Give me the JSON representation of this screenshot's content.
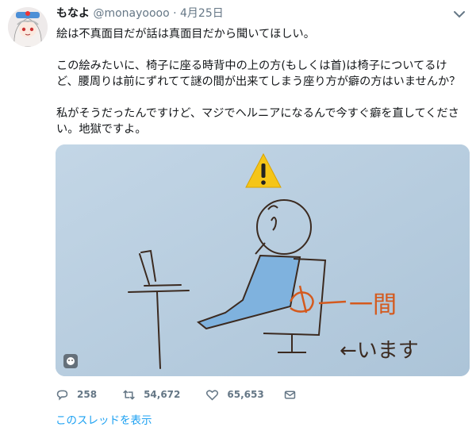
{
  "tweet": {
    "name": "もなよ",
    "handle": "@monayoooo",
    "separator": "·",
    "date": "4月25日",
    "text": "絵は不真面目だが話は真面目だから聞いてほしい。\n\nこの絵みたいに、椅子に座る時背中の上の方(もしくは首)は椅子についてるけど、腰周りは前にずれてて謎の間が出来てしまう座り方が癖の方はいませんか？\n\n私がそうだったんですけど、マジでヘルニアになるんで今すぐ癖を直してください。地獄ですよ。"
  },
  "media": {
    "drawing_text_ma": "一間",
    "drawing_text_imasu": "←います",
    "warning_icon": "⚠",
    "background_color": "#b8cee0"
  },
  "actions": {
    "reply_count": "258",
    "retweet_count": "54,672",
    "like_count": "65,653"
  },
  "thread_link": "このスレッドを表示",
  "colors": {
    "link": "#1da1f2",
    "muted": "#657786",
    "accent_orange": "#d45a1e"
  }
}
